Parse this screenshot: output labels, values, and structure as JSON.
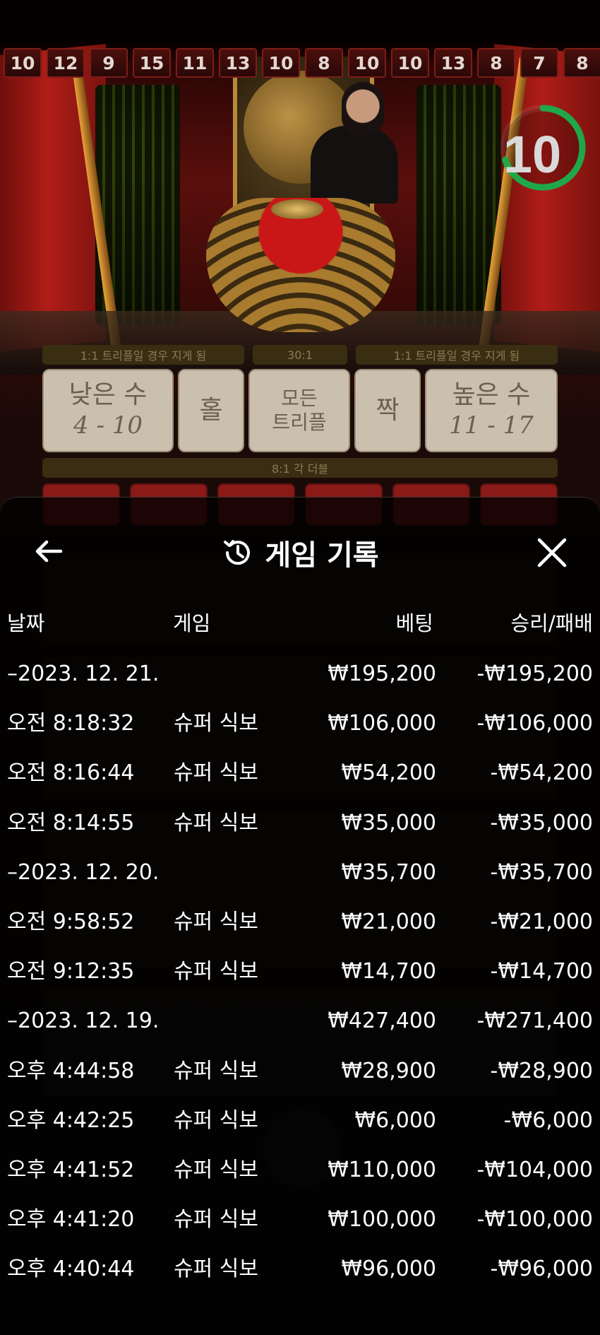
{
  "history_strip": [
    "10",
    "12",
    "9",
    "15",
    "11",
    "13",
    "10",
    "8",
    "10",
    "10",
    "13",
    "8",
    "7",
    "8"
  ],
  "timer": {
    "value": "10",
    "progress": 0.7,
    "color": "#1fa84a"
  },
  "board": {
    "low_payout": "1:1 트리플일 경우 지게 됨",
    "triple_payout": "30:1",
    "high_payout": "1:1 트리플일 경우 지게 됨",
    "low_label": "낮은 수",
    "low_range": "4 - 10",
    "odd_label": "홀",
    "any_triple_label_1": "모든",
    "any_triple_label_2": "트리플",
    "even_label": "짝",
    "high_label": "높은 수",
    "high_range": "11 - 17",
    "double_payout": "8:1 각 더블"
  },
  "panel": {
    "title": "게임 기록",
    "back_icon": "arrow-left-icon",
    "history_icon": "history-clock-icon",
    "close_icon": "close-icon",
    "columns": {
      "date": "날짜",
      "game": "게임",
      "bet": "베팅",
      "win_loss": "승리/패배"
    },
    "rows": [
      {
        "type": "day",
        "date": "–2023. 12. 21.",
        "game": "",
        "bet": "₩195,200",
        "win_loss": "-₩195,200"
      },
      {
        "type": "game",
        "date": "오전 8:18:32",
        "game": "슈퍼 식보",
        "bet": "₩106,000",
        "win_loss": "-₩106,000"
      },
      {
        "type": "game",
        "date": "오전 8:16:44",
        "game": "슈퍼 식보",
        "bet": "₩54,200",
        "win_loss": "-₩54,200"
      },
      {
        "type": "game",
        "date": "오전 8:14:55",
        "game": "슈퍼 식보",
        "bet": "₩35,000",
        "win_loss": "-₩35,000"
      },
      {
        "type": "day",
        "date": "–2023. 12. 20.",
        "game": "",
        "bet": "₩35,700",
        "win_loss": "-₩35,700"
      },
      {
        "type": "game",
        "date": "오전 9:58:52",
        "game": "슈퍼 식보",
        "bet": "₩21,000",
        "win_loss": "-₩21,000"
      },
      {
        "type": "game",
        "date": "오전 9:12:35",
        "game": "슈퍼 식보",
        "bet": "₩14,700",
        "win_loss": "-₩14,700"
      },
      {
        "type": "day",
        "date": "–2023. 12. 19.",
        "game": "",
        "bet": "₩427,400",
        "win_loss": "-₩271,400"
      },
      {
        "type": "game",
        "date": "오후 4:44:58",
        "game": "슈퍼 식보",
        "bet": "₩28,900",
        "win_loss": "-₩28,900"
      },
      {
        "type": "game",
        "date": "오후 4:42:25",
        "game": "슈퍼 식보",
        "bet": "₩6,000",
        "win_loss": "-₩6,000"
      },
      {
        "type": "game",
        "date": "오후 4:41:52",
        "game": "슈퍼 식보",
        "bet": "₩110,000",
        "win_loss": "-₩104,000"
      },
      {
        "type": "game",
        "date": "오후 4:41:20",
        "game": "슈퍼 식보",
        "bet": "₩100,000",
        "win_loss": "-₩100,000"
      },
      {
        "type": "game",
        "date": "오후 4:40:44",
        "game": "슈퍼 식보",
        "bet": "₩96,000",
        "win_loss": "-₩96,000"
      }
    ]
  },
  "colors": {
    "panel_bg": "#000000",
    "text": "#ffffff",
    "felt": "#cbbfae",
    "curtain": "#b11d17"
  }
}
